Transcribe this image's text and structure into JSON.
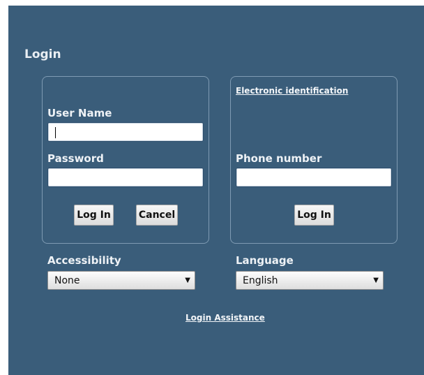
{
  "page_title": "Login",
  "left_box": {
    "username_label": "User Name",
    "username_value": "",
    "password_label": "Password",
    "password_value": "",
    "login_button": "Log In",
    "cancel_button": "Cancel"
  },
  "right_box": {
    "eid_link": "Electronic identification",
    "phone_label": "Phone number",
    "phone_value": "",
    "login_button": "Log In"
  },
  "accessibility": {
    "label": "Accessibility",
    "selected": "None"
  },
  "language": {
    "label": "Language",
    "selected": "English"
  },
  "login_assistance_link": "Login Assistance",
  "colors": {
    "panel_background": "#3a5d7a",
    "box_border": "#7f9bb3",
    "text": "#eef2f6"
  },
  "icons": {
    "dropdown": "chevron-down-icon"
  }
}
